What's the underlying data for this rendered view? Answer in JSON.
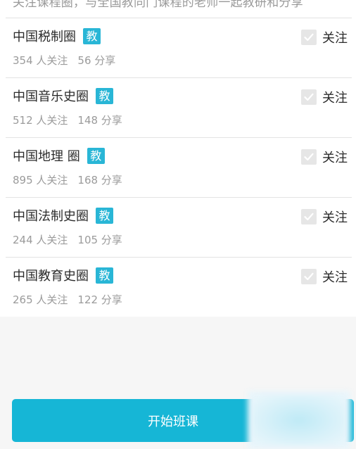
{
  "header": {
    "hint": "关注课程圈，与全国教同门课程的老师一起教研和分享"
  },
  "badge_text": "教",
  "follow_label": "关注",
  "items": [
    {
      "name": "中国税制圈",
      "followers": "354 人关注",
      "shares": "56 分享",
      "followed": true
    },
    {
      "name": "中国音乐史圈",
      "followers": "512 人关注",
      "shares": "148 分享",
      "followed": true
    },
    {
      "name": "中国地理 圈",
      "followers": "895 人关注",
      "shares": "168 分享",
      "followed": true
    },
    {
      "name": "中国法制史圈",
      "followers": "244 人关注",
      "shares": "105 分享",
      "followed": true
    },
    {
      "name": "中国教育史圈",
      "followers": "265 人关注",
      "shares": "122 分享",
      "followed": true
    }
  ],
  "start_button": {
    "label": "开始班课"
  },
  "colors": {
    "accent": "#16b6d6",
    "badge": "#29b6d6",
    "check_bg": "#e6e6e6"
  }
}
